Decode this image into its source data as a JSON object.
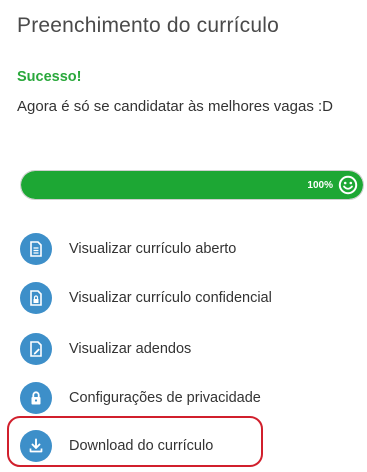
{
  "header": {
    "title": "Preenchimento do currículo"
  },
  "status": {
    "title": "Sucesso!",
    "message": "Agora é só se candidatar às melhores vagas :D",
    "success_color": "#2aa83c"
  },
  "progress": {
    "percent": 100,
    "label": "100%",
    "fill_color": "#1da734",
    "end_icon": "smile-icon"
  },
  "menu": {
    "icon_color": "#3d8fc9",
    "items": [
      {
        "label": "Visualizar currículo aberto",
        "icon": "document-icon"
      },
      {
        "label": "Visualizar currículo confidencial",
        "icon": "confidential-document-icon"
      },
      {
        "label": "Visualizar adendos",
        "icon": "addendum-icon"
      },
      {
        "label": "Configurações de privacidade",
        "icon": "lock-icon"
      },
      {
        "label": "Download do currículo",
        "icon": "download-icon"
      }
    ]
  },
  "annotation": {
    "highlight_color": "#d11f2c"
  }
}
